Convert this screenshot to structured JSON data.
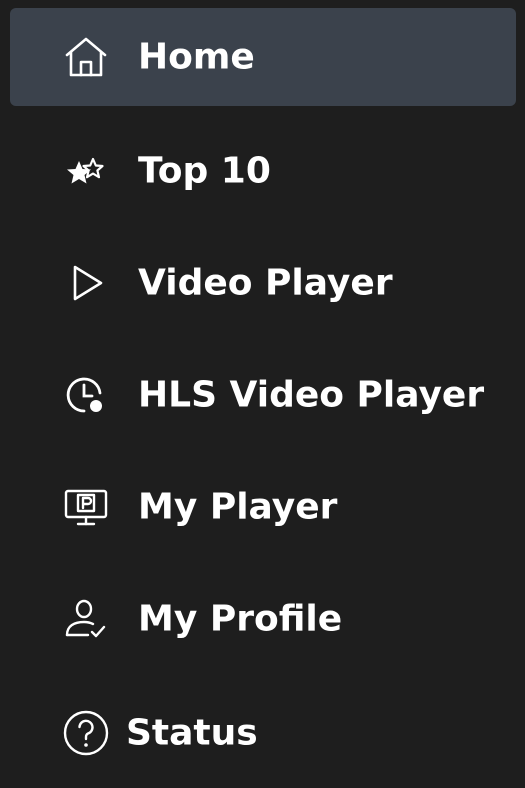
{
  "nav": {
    "items": [
      {
        "label": "Home",
        "icon": "home-icon",
        "active": true
      },
      {
        "label": "Top 10",
        "icon": "stars-icon",
        "active": false
      },
      {
        "label": "Video Player",
        "icon": "play-icon",
        "active": false
      },
      {
        "label": "HLS Video Player",
        "icon": "clock-icon",
        "active": false
      },
      {
        "label": "My Player",
        "icon": "monitor-p-icon",
        "active": false
      },
      {
        "label": "My Profile",
        "icon": "user-check-icon",
        "active": false
      },
      {
        "label": "Status",
        "icon": "help-circle-icon",
        "active": false
      }
    ]
  },
  "colors": {
    "background": "#1e1e1e",
    "active_background": "#3b424c",
    "text": "#ffffff"
  }
}
